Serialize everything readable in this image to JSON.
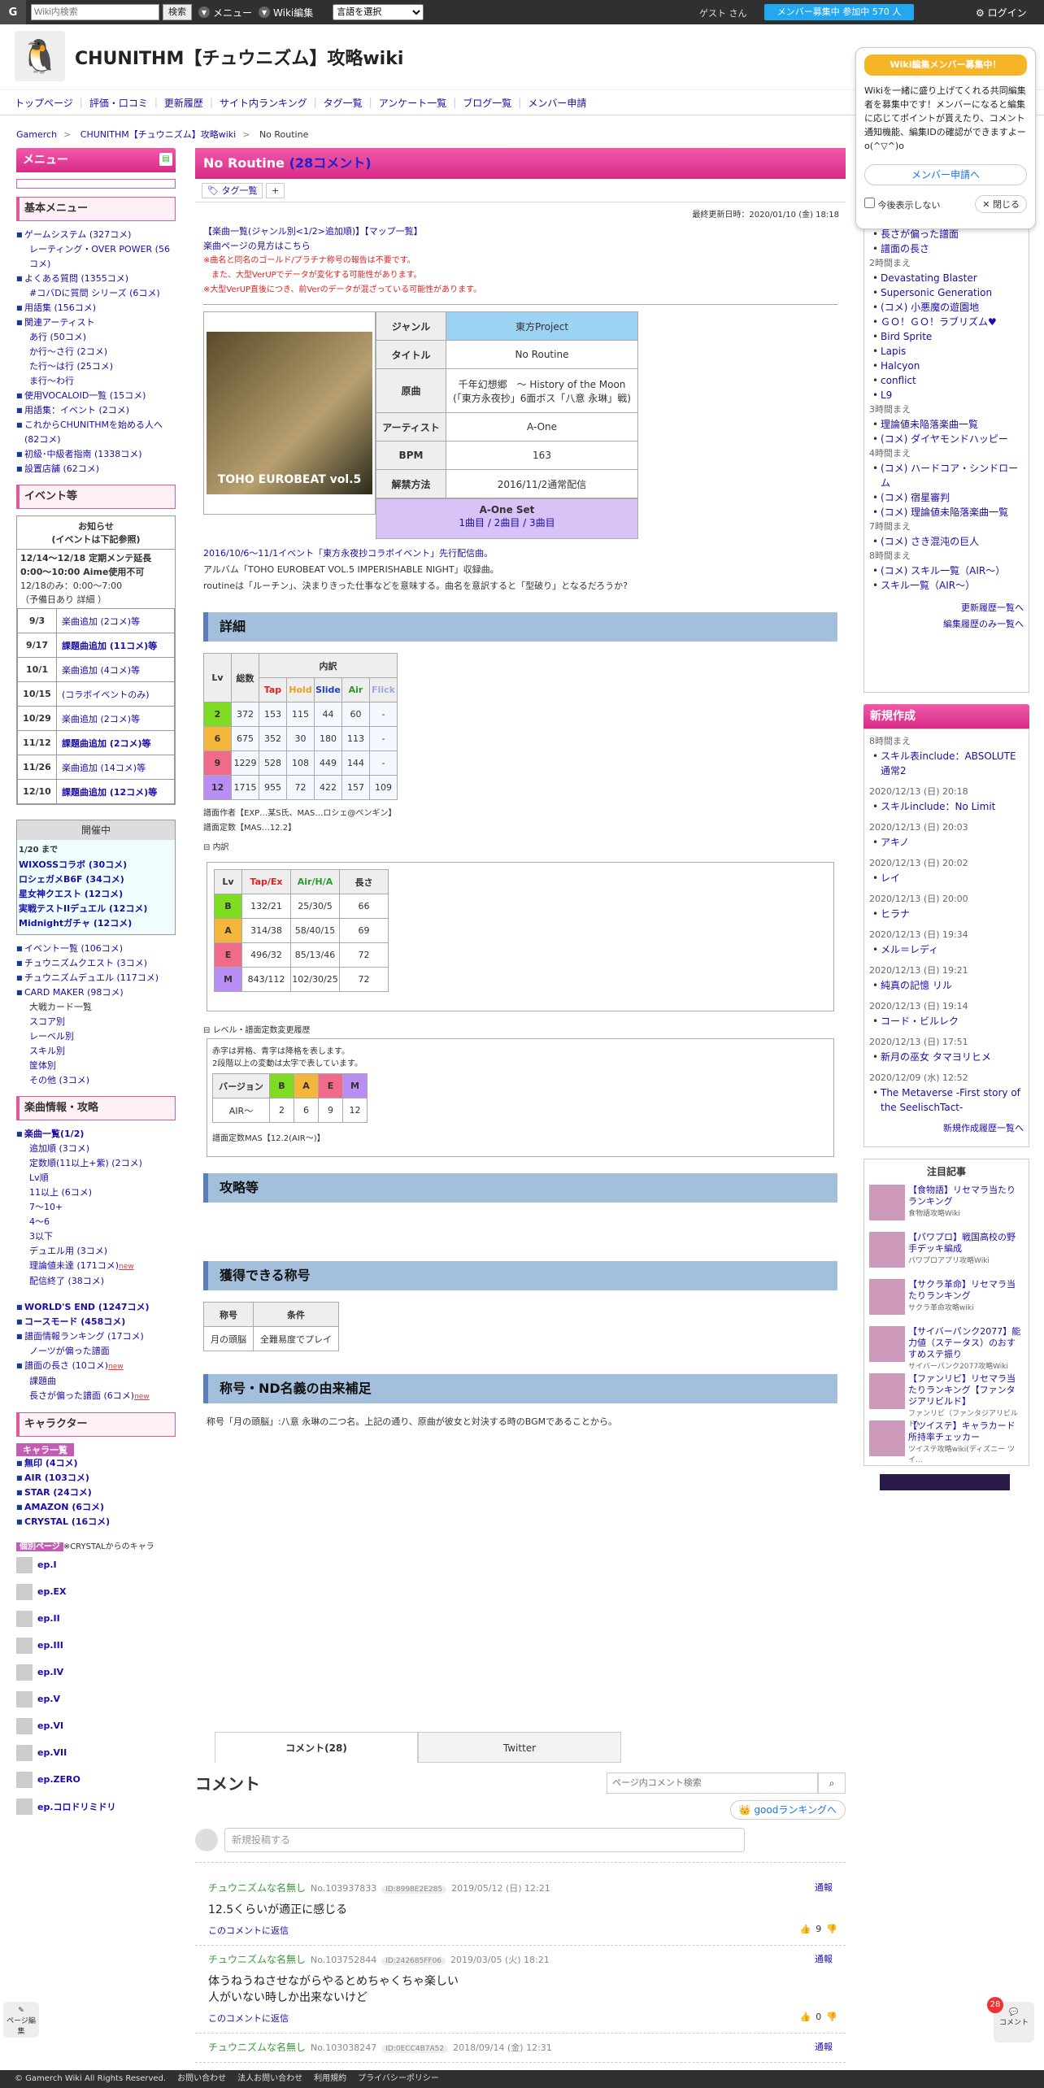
{
  "topbar": {
    "logo": "G",
    "search_placeholder": "Wiki内検索",
    "search_button": "検索",
    "menu": "メニュー",
    "wiki_edit": "Wiki編集",
    "lang_select": "言語を選択",
    "guest": "ゲスト さん",
    "member_recruit": "メンバー募集中 参加中 570 人",
    "login": "ログイン"
  },
  "header": {
    "title": "CHUNITHM【チュウニズム】攻略wiki",
    "avatar_icon": "🐧"
  },
  "gnav": [
    "トップページ",
    "評価・口コミ",
    "更新履歴",
    "サイト内ランキング",
    "タグ一覧",
    "アンケート一覧",
    "ブログ一覧",
    "メンバー申請"
  ],
  "breadcrumb": [
    "Gamerch",
    "CHUNITHM【チュウニズム】攻略wiki",
    "No Routine"
  ],
  "popup": {
    "title": "Wiki編集メンバー募集中！",
    "text": "Wikiを一緒に盛り上げてくれる共同編集者を募集中です！メンバーになると編集に応じてポイントが貰えたり、コメント通知機能、編集IDの確認ができますよーo(^▽^)o",
    "button": "メンバー申請へ",
    "hide": "今後表示しない",
    "close": "閉じる"
  },
  "left": {
    "menu_title": "メニュー",
    "basic_title": "基本メニュー",
    "basic": [
      "ゲームシステム (327コメ)",
      "レーティング・OVER POWER (56コメ)",
      "よくある質問 (1355コメ)",
      "#コバDに質問 シリーズ (6コメ)",
      "用語集 (156コメ)",
      "関連アーティスト",
      "あ行 (50コメ)",
      "か行～さ行 (2コメ)",
      "た行～は行 (25コメ)",
      "ま行～わ行",
      "使用VOCALOID一覧 (15コメ)",
      "用語集：イベント (2コメ)",
      "これからCHUNITHMを始める人へ (82コメ)",
      "初級･中級者指南 (1338コメ)",
      "設置店舗 (62コメ)"
    ],
    "event_title": "イベント等",
    "notice": {
      "title": "お知らせ\n(イベントは下記参照)",
      "lines": [
        "12/14～12/18 定期メンテ延長",
        "0:00～10:00 Aime使用不可",
        "12/18のみ：0:00～7:00",
        "（予備日あり 詳細 ）"
      ]
    },
    "events": [
      [
        "9/3",
        "楽曲追加 (2コメ)等"
      ],
      [
        "9/17",
        "課題曲追加 (11コメ)等"
      ],
      [
        "10/1",
        "楽曲追加 (4コメ)等"
      ],
      [
        "10/15",
        "(コラボイベントのみ)"
      ],
      [
        "10/29",
        "楽曲追加 (2コメ)等"
      ],
      [
        "11/12",
        "課題曲追加 (2コメ)等"
      ],
      [
        "11/26",
        "楽曲追加 (14コメ)等"
      ],
      [
        "12/10",
        "課題曲追加 (12コメ)等"
      ]
    ],
    "open_title": "開催中",
    "open_until": "1/20 まで",
    "open_items": [
      "WIXOSSコラボ (30コメ)",
      "ロシェガメB6F (34コメ)",
      "星女神クエスト (12コメ)",
      "実戦テストIIデュエル (12コメ)",
      "Midnightガチャ (12コメ)"
    ],
    "event_links": [
      "イベント一覧 (106コメ)",
      "チュウニズムクエスト (3コメ)",
      "チュウニズムデュエル (117コメ)",
      "CARD MAKER (98コメ)",
      "大戦カード一覧",
      "スコア別",
      "レーベル別",
      "スキル別",
      "筐体別",
      "その他 (3コメ)"
    ],
    "song_title": "楽曲情報・攻略",
    "songs": [
      "楽曲一覧(1/2)",
      "追加順 (3コメ)",
      "定数順(11以上+紫) (2コメ)",
      "Lv順",
      "11以上 (6コメ)",
      "7～10+",
      "4～6",
      "3以下",
      "デュエル用 (3コメ)",
      "理論値未達 (171コメ)",
      "配信終了 (38コメ)",
      "WORLD'S END (1247コメ)",
      "コースモード (458コメ)",
      "譜面情報ランキング (17コメ)",
      "ノーツが偏った譜面",
      "譜面の長さ (10コメ)",
      "課題曲",
      "長さが偏った譜面 (6コメ)"
    ],
    "new": "new",
    "chara_title": "キャラクター",
    "chara_sub": "キャラ一覧",
    "charas": [
      "無印 (4コメ)",
      "AIR (103コメ)",
      "STAR (24コメ)",
      "AMAZON (6コメ)",
      "CRYSTAL (16コメ)"
    ],
    "indiv_label": "個別ページ",
    "indiv_note": "※CRYSTALからのキャラ",
    "eps": [
      "ep.I",
      "ep.EX",
      "ep.II",
      "ep.III",
      "ep.IV",
      "ep.V",
      "ep.VI",
      "ep.VII",
      "ep.ZERO",
      "ep.コロドリミドリ"
    ]
  },
  "main": {
    "title": "No Routine",
    "comment_count": "(28コメント)",
    "tag": "タグ一覧",
    "updated": "最終更新日時：2020/01/10 (金) 18:18",
    "nav": "【楽曲一覧(ジャンル別<1/2>追加順)】【マップ一覧】",
    "howto": "楽曲ページの見方はこちら",
    "notes": [
      "※曲名と同名のゴールド/プラチナ称号の報告は不要です。",
      "　また、大型VerUPでデータが変化する可能性があります。",
      "※大型VerUP直後につき、前Verのデータが混ざっている可能性があります。"
    ],
    "jacket_caption": "TOHO EUROBEAT vol.5",
    "info": [
      [
        "ジャンル",
        "東方Project"
      ],
      [
        "タイトル",
        "No Routine"
      ],
      [
        "原曲",
        "千年幻想郷　～ History of the Moon\n(「東方永夜抄」6面ボス「八意 永琳」戦)"
      ],
      [
        "アーティスト",
        "A-One"
      ],
      [
        "BPM",
        "163"
      ],
      [
        "解禁方法",
        "2016/11/2通常配信"
      ]
    ],
    "set_title": "A-One Set",
    "set_links": "1曲目 / 2曲目 / 3曲目",
    "desc1": "2016/10/6～11/1イベント「東方永夜抄コラボイベント」先行配信曲。",
    "desc2": "アルバム「TOHO EUROBEAT VOL.5 IMPERISHABLE NIGHT」収録曲。",
    "desc3": "routineは「ルーチン」、決まりきった仕事などを意味する。曲名を意訳すると「型破り」となるだろうか?",
    "sec_detail": "詳細",
    "detail_head": [
      "Lv",
      "総数",
      "内訳",
      "Tap",
      "Hold",
      "Slide",
      "Air",
      "Flick"
    ],
    "detail_rows": [
      [
        "2",
        "372",
        "153",
        "115",
        "44",
        "60",
        "-"
      ],
      [
        "6",
        "675",
        "352",
        "30",
        "180",
        "113",
        "-"
      ],
      [
        "9",
        "1229",
        "528",
        "108",
        "449",
        "144",
        "-"
      ],
      [
        "12",
        "1715",
        "955",
        "72",
        "422",
        "157",
        "109"
      ]
    ],
    "chart_author": "譜面作者【EXP…某S氏、MAS…ロシェ@ペンギン】",
    "chart_const": "譜面定数【MAS…12.2】",
    "inner_label": "内訳",
    "inner_head": [
      "Lv",
      "Tap/Ex",
      "Air/H/A",
      "長さ"
    ],
    "inner_rows": [
      [
        "B",
        "132/21",
        "25/30/5",
        "66"
      ],
      [
        "A",
        "314/38",
        "58/40/15",
        "69"
      ],
      [
        "E",
        "496/32",
        "85/13/46",
        "72"
      ],
      [
        "M",
        "843/112",
        "102/30/25",
        "72"
      ]
    ],
    "history_label": "レベル・譜面定数変更履歴",
    "history_notes": [
      "赤字は昇格、青字は降格を表します。",
      "2段階以上の変動は太字で表しています。"
    ],
    "ver_head": [
      "バージョン",
      "B",
      "A",
      "E",
      "M"
    ],
    "ver_row": [
      "AIR～",
      "2",
      "6",
      "9",
      "12"
    ],
    "ver_const": "譜面定数MAS【12.2(AIR～)】",
    "sec_strategy": "攻略等",
    "sec_title": "獲得できる称号",
    "title_head": [
      "称号",
      "条件"
    ],
    "title_row": [
      "月の頭脳",
      "全難易度でプレイ"
    ],
    "sec_origin": "称号・ND名義の由来補足",
    "origin_text": "称号「月の頭脳」:八意 永琳の二つ名。上記の通り、原曲が彼女と対決する時のBGMであることから。",
    "tab_comment": "コメント(28)",
    "tab_twitter": "Twitter",
    "comments_h": "コメント",
    "comment_search": "ページ内コメント検索",
    "good_rank": "goodランキングへ",
    "new_post": "新規投稿する",
    "comments": [
      {
        "name": "チュウニズムな名無し",
        "no": "No.103937833",
        "id": "ID:8998E2E285",
        "date": "2019/05/12 (日) 12:21",
        "body": "12.5くらいが適正に感じる",
        "reply": "このコメントに返信",
        "good": "9"
      },
      {
        "name": "チュウニズムな名無し",
        "no": "No.103752844",
        "id": "ID:242685FF06",
        "date": "2019/03/05 (火) 18:21",
        "body": "体うねうねさせながらやるとめちゃくちゃ楽しい\n人がいない時しか出来ないけど",
        "reply": "このコメントに返信",
        "good": "0"
      },
      {
        "name": "チュウニズムな名無し",
        "no": "No.103038247",
        "id": "ID:0ECC4B7A52",
        "date": "2018/09/14 (金) 12:31",
        "body": "",
        "reply": "",
        "good": ""
      }
    ],
    "report": "通報"
  },
  "right": {
    "upd_top": [
      "長さが偏った譜面",
      "譜面の長さ"
    ],
    "upd": [
      [
        "2時間まえ",
        [
          "Devastating Blaster",
          "Supersonic Generation",
          "(コメ) 小悪魔の遊園地",
          "ＧＯ！ＧＯ！ラブリズム♥",
          "Bird Sprite",
          "Lapis",
          "Halcyon",
          "conflict",
          "L9"
        ]
      ],
      [
        "3時間まえ",
        [
          "理論値未陥落楽曲一覧",
          "(コメ) ダイヤモンドハッピー"
        ]
      ],
      [
        "4時間まえ",
        [
          "(コメ) ハードコア・シンドローム",
          "(コメ) 宿星審判",
          "(コメ) 理論値未陥落楽曲一覧"
        ]
      ],
      [
        "7時間まえ",
        [
          "(コメ) さき混沌の巨人"
        ]
      ],
      [
        "8時間まえ",
        [
          "(コメ) スキル一覧（AIR～）",
          "スキル一覧（AIR～）"
        ]
      ]
    ],
    "upd_more": "更新履歴一覧へ",
    "upd_edit": "編集履歴のみ一覧へ",
    "new_title": "新規作成",
    "new_items": [
      [
        "8時間まえ",
        "スキル表include：ABSOLUTE通常2"
      ],
      [
        "2020/12/13 (日) 20:18",
        "スキルinclude：No Limit"
      ],
      [
        "2020/12/13 (日) 20:03",
        "アキノ"
      ],
      [
        "2020/12/13 (日) 20:02",
        "レイ"
      ],
      [
        "2020/12/13 (日) 20:00",
        "ヒラナ"
      ],
      [
        "2020/12/13 (日) 19:34",
        "メル＝レディ"
      ],
      [
        "2020/12/13 (日) 19:21",
        "純真の記憶 リル"
      ],
      [
        "2020/12/13 (日) 19:14",
        "コード・ビルレク"
      ],
      [
        "2020/12/13 (日) 17:51",
        "新月の巫女 タマヨリヒメ"
      ],
      [
        "2020/12/09 (水) 12:52",
        "The Metaverse -First story of the SeelischTact-"
      ]
    ],
    "new_more": "新規作成履歴一覧へ",
    "feat_title": "注目記事",
    "feat": [
      [
        "【食物語】リセマラ当たりランキング",
        "食物語攻略Wiki"
      ],
      [
        "【パワプロ】戦国高校の野手デッキ編成",
        "パワプロアプリ攻略Wiki"
      ],
      [
        "【サクラ革命】リセマラ当たりランキング",
        "サクラ革命攻略wiki"
      ],
      [
        "【サイバーパンク2077】能力値（ステータス）のおすすめステ振り",
        "サイバーパンク2077攻略Wiki"
      ],
      [
        "【ファンリビ】リセマラ当たりランキング【ファンタジアリビルド】",
        "ファンリビ（ファンタジアリビルド）"
      ],
      [
        "【ツイステ】キャラカード所持率チェッカー",
        "ツイステ攻略wiki(ディズニー ツイ..."
      ]
    ]
  },
  "float": {
    "left_label": "ページ編集",
    "right_label": "コメント",
    "badge": "28"
  },
  "footer": [
    "© Gamerch Wiki All Rights Reserved.",
    "お問い合わせ",
    "法人お問い合わせ",
    "利用規約",
    "プライバシーポリシー"
  ],
  "colors": {
    "pink": "#d82a88",
    "blue": "#a4bfdc",
    "accent": "#22a7f0"
  }
}
